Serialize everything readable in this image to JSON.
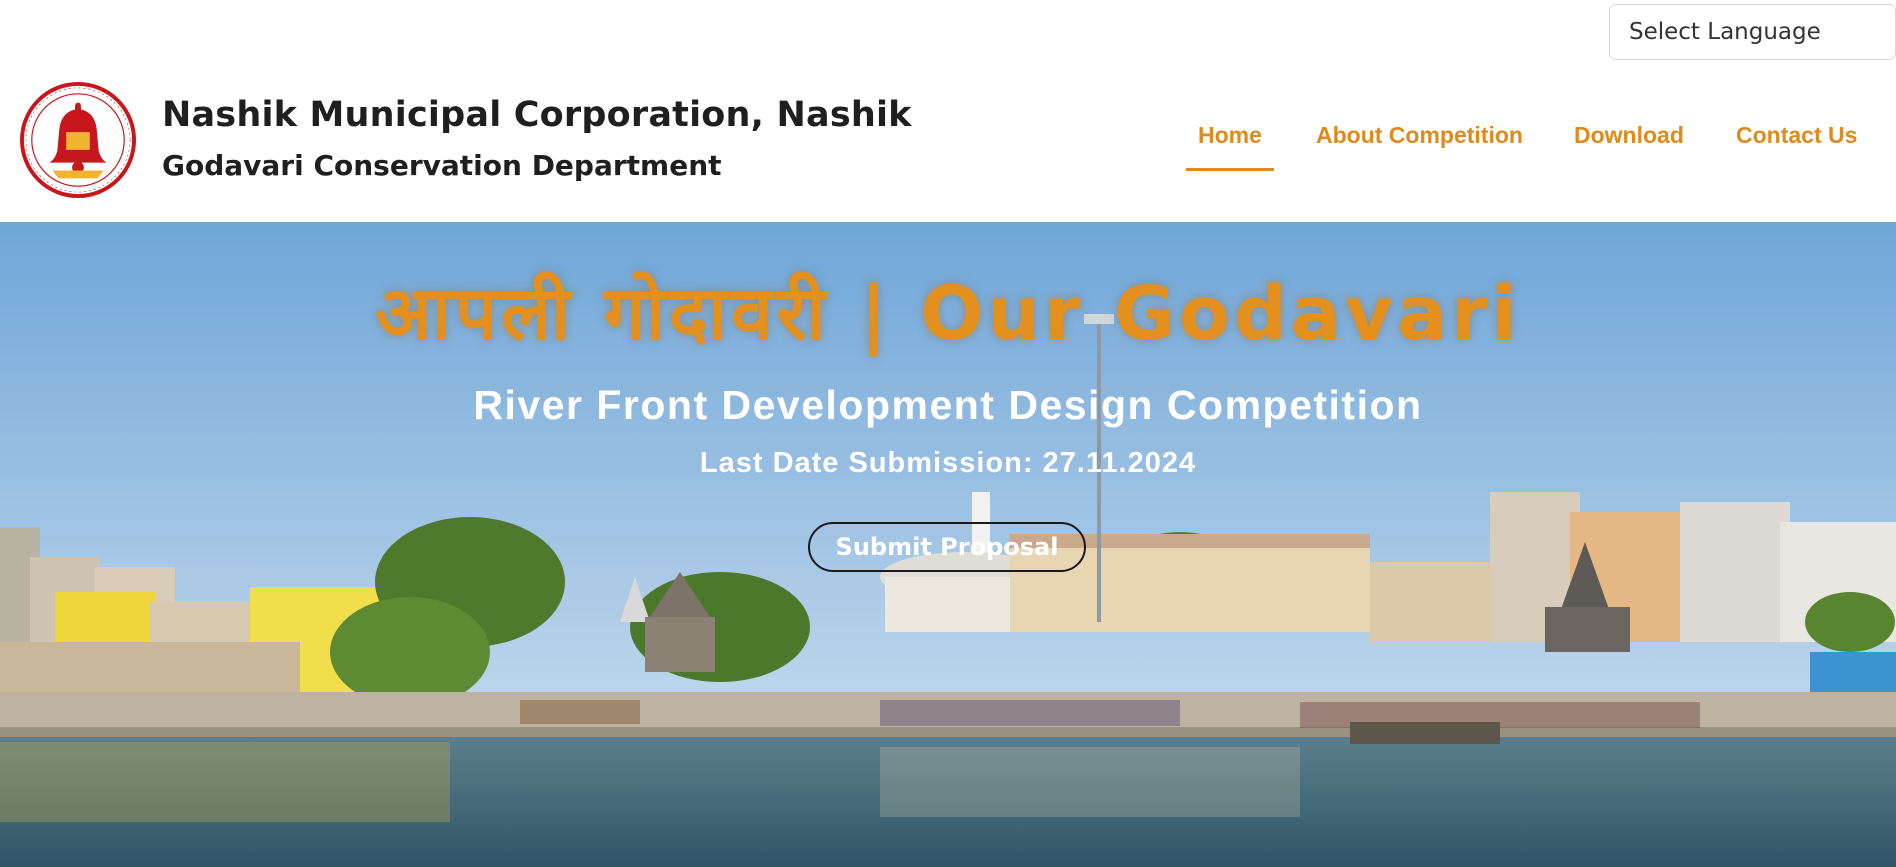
{
  "header": {
    "language_select": {
      "selected": "Select Language"
    },
    "logo": {
      "name": "nmc-bell-logo-icon",
      "brand_color": "#c8161d"
    },
    "org_title": "Nashik Municipal Corporation, Nashik",
    "dept_title": "Godavari Conservation Department"
  },
  "nav": {
    "items": [
      {
        "label": "Home",
        "active": true
      },
      {
        "label": "About Competition",
        "active": false
      },
      {
        "label": "Download",
        "active": false
      },
      {
        "label": "Contact Us",
        "active": false
      }
    ],
    "accent_color": "#e08a1c"
  },
  "hero": {
    "headline": "आपली गोदावरी | Our Godavari",
    "subtitle": "River Front Development Design Competition",
    "last_date": "Last Date Submission: 27.11.2024",
    "submit_label": "Submit Proposal",
    "background_image": "godavari-ghat-riverfront-photo",
    "headline_color": "#e3901f"
  }
}
